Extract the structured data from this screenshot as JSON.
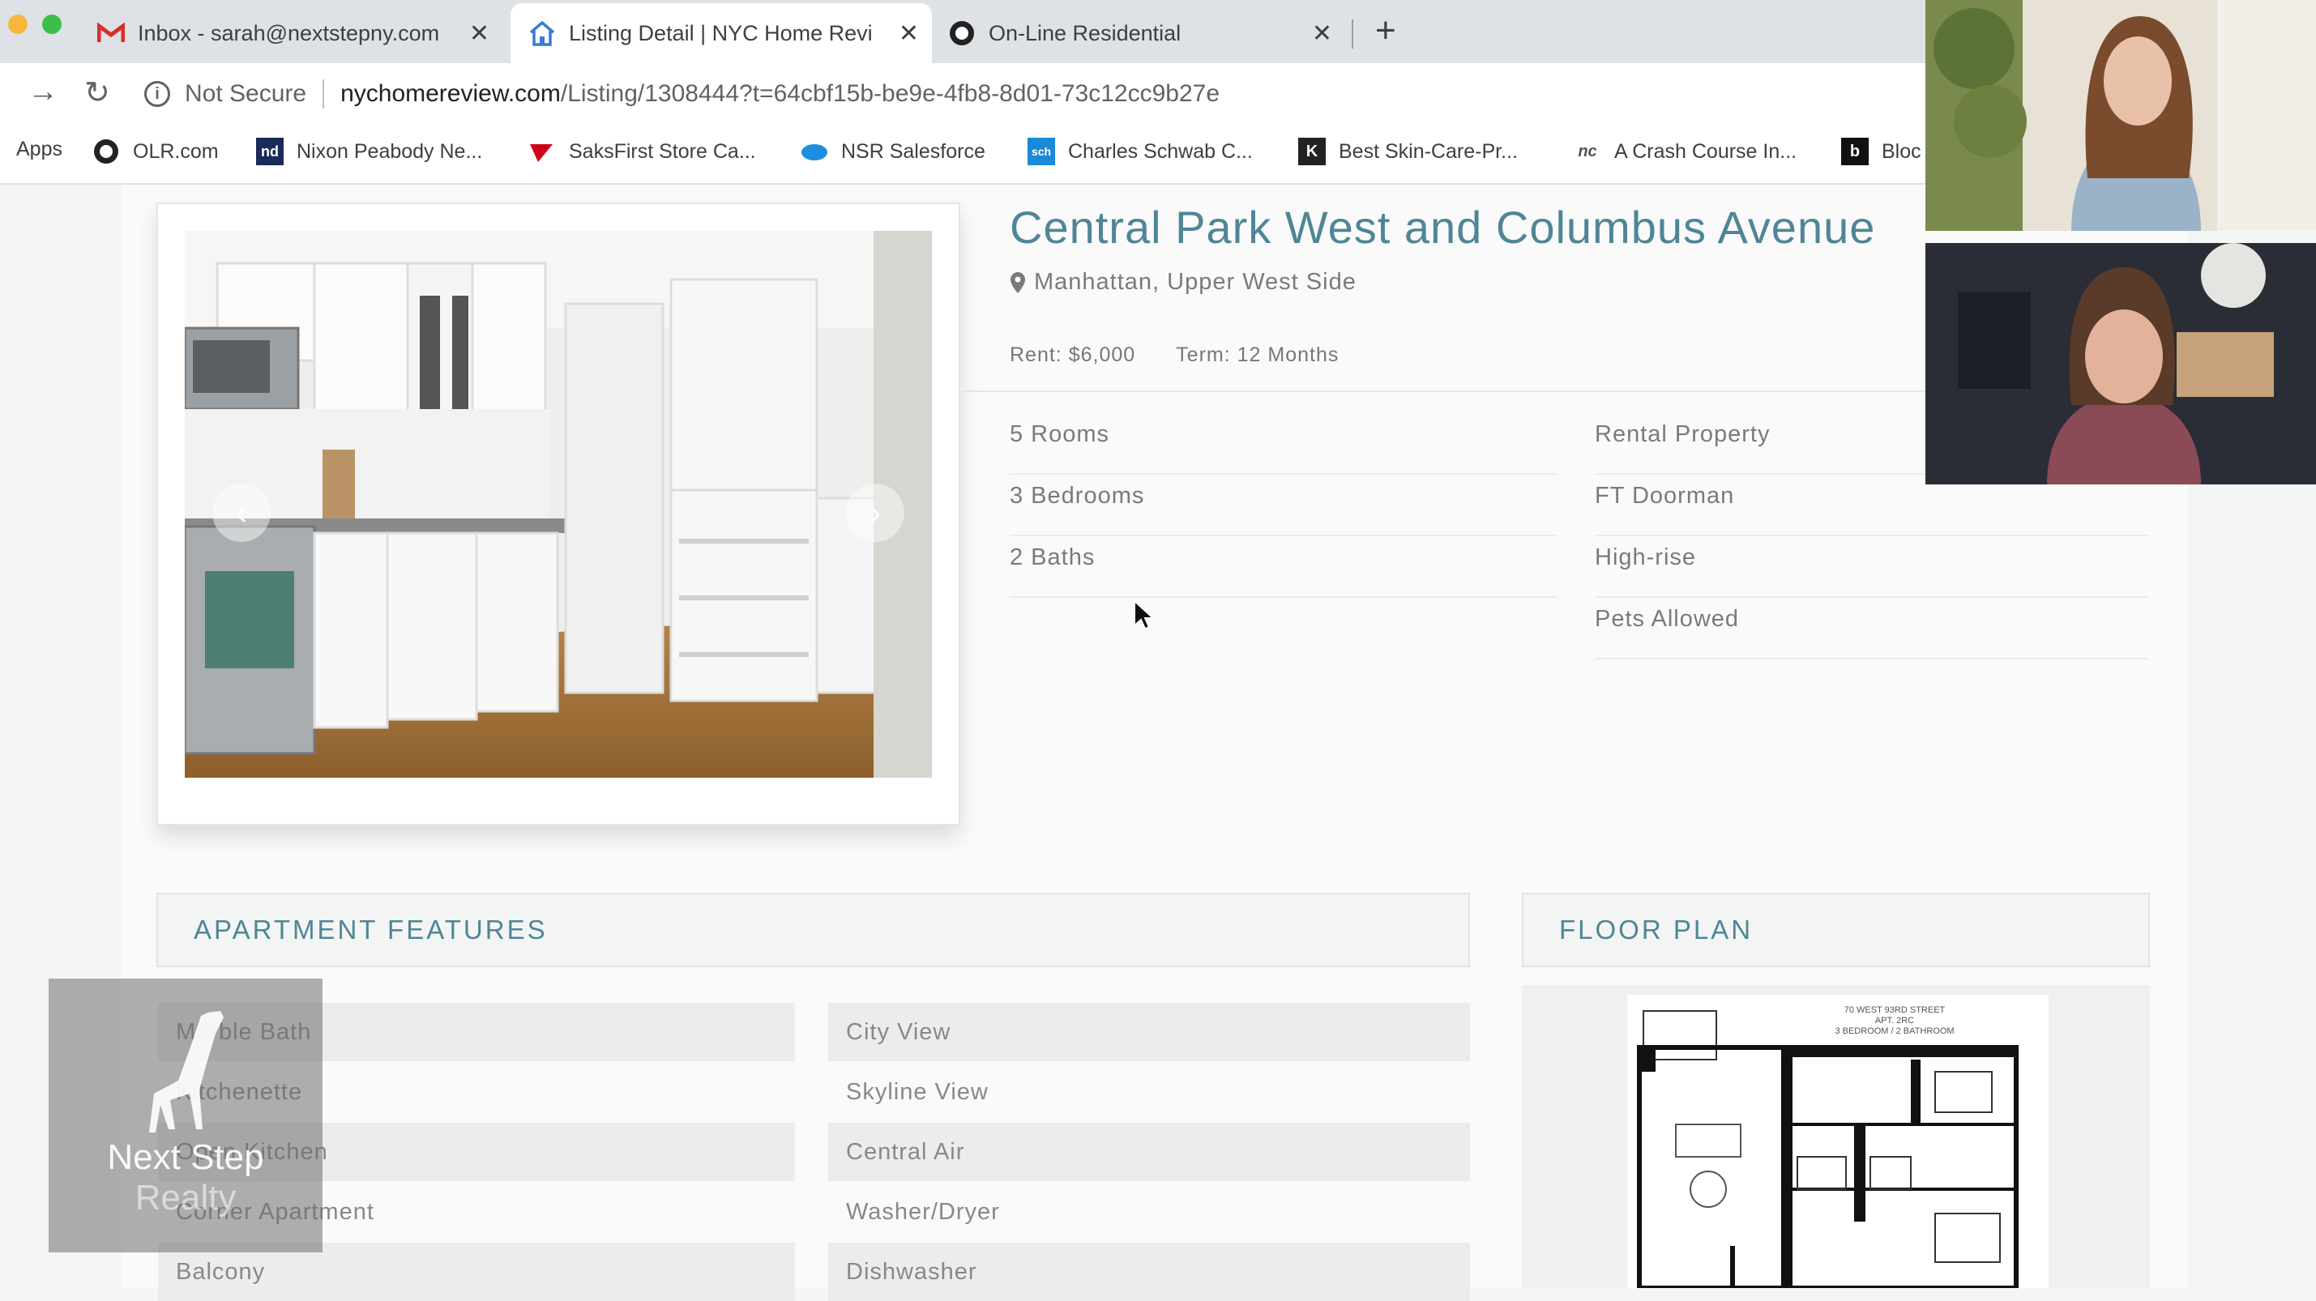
{
  "browser": {
    "tabs": [
      {
        "title": "Inbox - sarah@nextstepny.com",
        "icon": "gmail-icon"
      },
      {
        "title": "Listing Detail | NYC Home Revi",
        "icon": "home-icon"
      },
      {
        "title": "On-Line Residential",
        "icon": "olr-icon"
      }
    ],
    "new_tab_label": "+",
    "address": {
      "security": "Not Secure",
      "host": "nychomereview.com",
      "path": "/Listing/1308444?t=64cbf15b-be9e-4fb8-8d01-73c12cc9b27e"
    },
    "bookmarks": [
      {
        "label": "Apps",
        "icon": "apps-icon"
      },
      {
        "label": "OLR.com",
        "icon": "olr-icon"
      },
      {
        "label": "Nixon Peabody Ne...",
        "icon": "nd-icon"
      },
      {
        "label": "SaksFirst Store Ca...",
        "icon": "saks-icon"
      },
      {
        "label": "NSR Salesforce",
        "icon": "salesforce-icon"
      },
      {
        "label": "Charles Schwab C...",
        "icon": "schwab-icon"
      },
      {
        "label": "Best Skin-Care-Pr...",
        "icon": "skincare-icon"
      },
      {
        "label": "A Crash Course In...",
        "icon": "crash-course-icon"
      },
      {
        "label": "Bloc",
        "icon": "b-icon"
      }
    ]
  },
  "listing": {
    "title": "Central Park West and Columbus Avenue",
    "location": "Manhattan, Upper West Side",
    "rent": "Rent: $6,000",
    "term": "Term: 12 Months",
    "specs_left": [
      "5 Rooms",
      "3 Bedrooms",
      "2 Baths"
    ],
    "specs_right": [
      "Rental Property",
      "FT Doorman",
      "High-rise",
      "Pets Allowed"
    ]
  },
  "features": {
    "heading": "APARTMENT FEATURES",
    "col1": [
      "Marble Bath",
      "Kitchenette",
      "Open Kitchen",
      "Corner Apartment",
      "Balcony"
    ],
    "col2": [
      "City View",
      "Skyline View",
      "Central Air",
      "Washer/Dryer",
      "Dishwasher"
    ]
  },
  "floor_plan": {
    "heading": "FLOOR PLAN",
    "caption": "70 WEST 93RD STREET\nAPT. 2RC\n3 BEDROOM / 2 BATHROOM"
  },
  "watermark": {
    "line1": "Next Step",
    "line2": "Realty"
  },
  "colors": {
    "accent": "#4f8696",
    "text_muted": "#7a7a7a"
  }
}
